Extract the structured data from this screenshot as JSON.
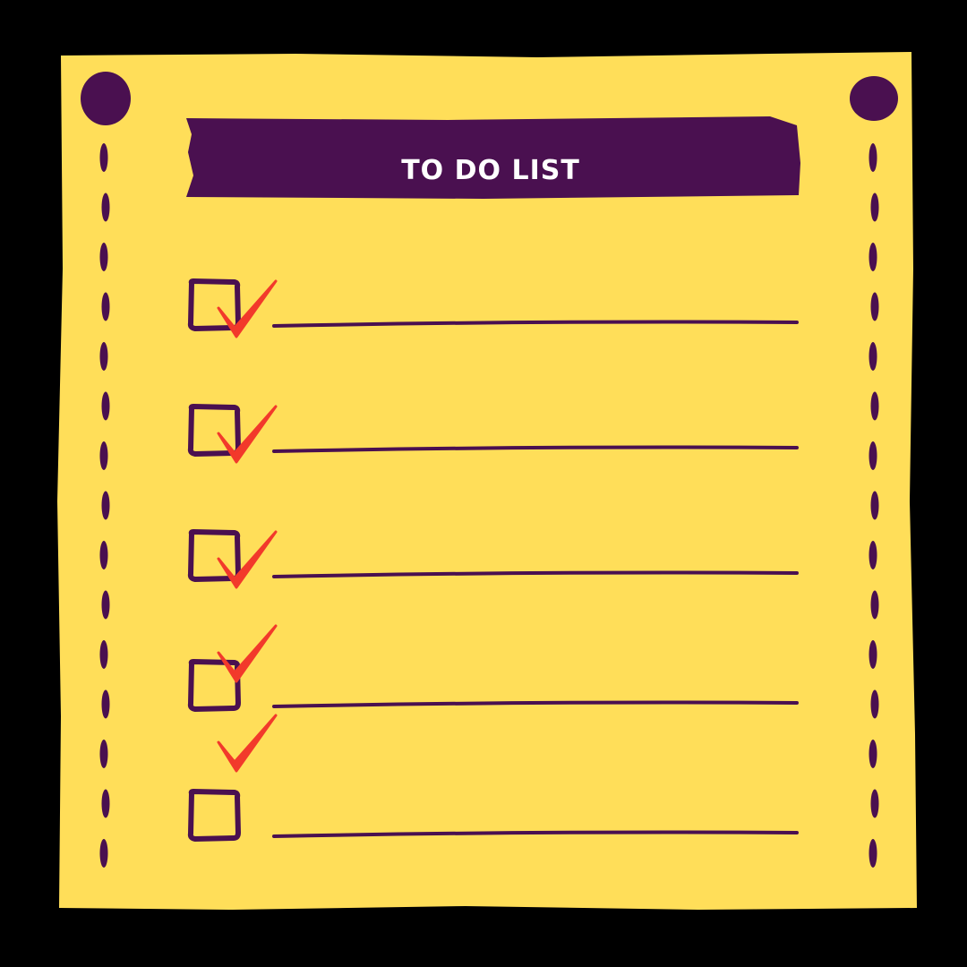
{
  "colors": {
    "background": "#000000",
    "paper": "#FFDE59",
    "ink": "#4A1050",
    "title_text": "#FFFFFF",
    "checkmark": "#F2392B"
  },
  "header": {
    "title": "TO DO LIST"
  },
  "list": {
    "items": [
      {
        "checked": true,
        "text": ""
      },
      {
        "checked": true,
        "text": ""
      },
      {
        "checked": true,
        "text": ""
      },
      {
        "checked": true,
        "text": ""
      },
      {
        "checked": true,
        "text": ""
      }
    ]
  },
  "icons": {
    "pin": "pin-icon",
    "checkbox": "checkbox-icon",
    "checkmark": "checkmark-icon"
  }
}
